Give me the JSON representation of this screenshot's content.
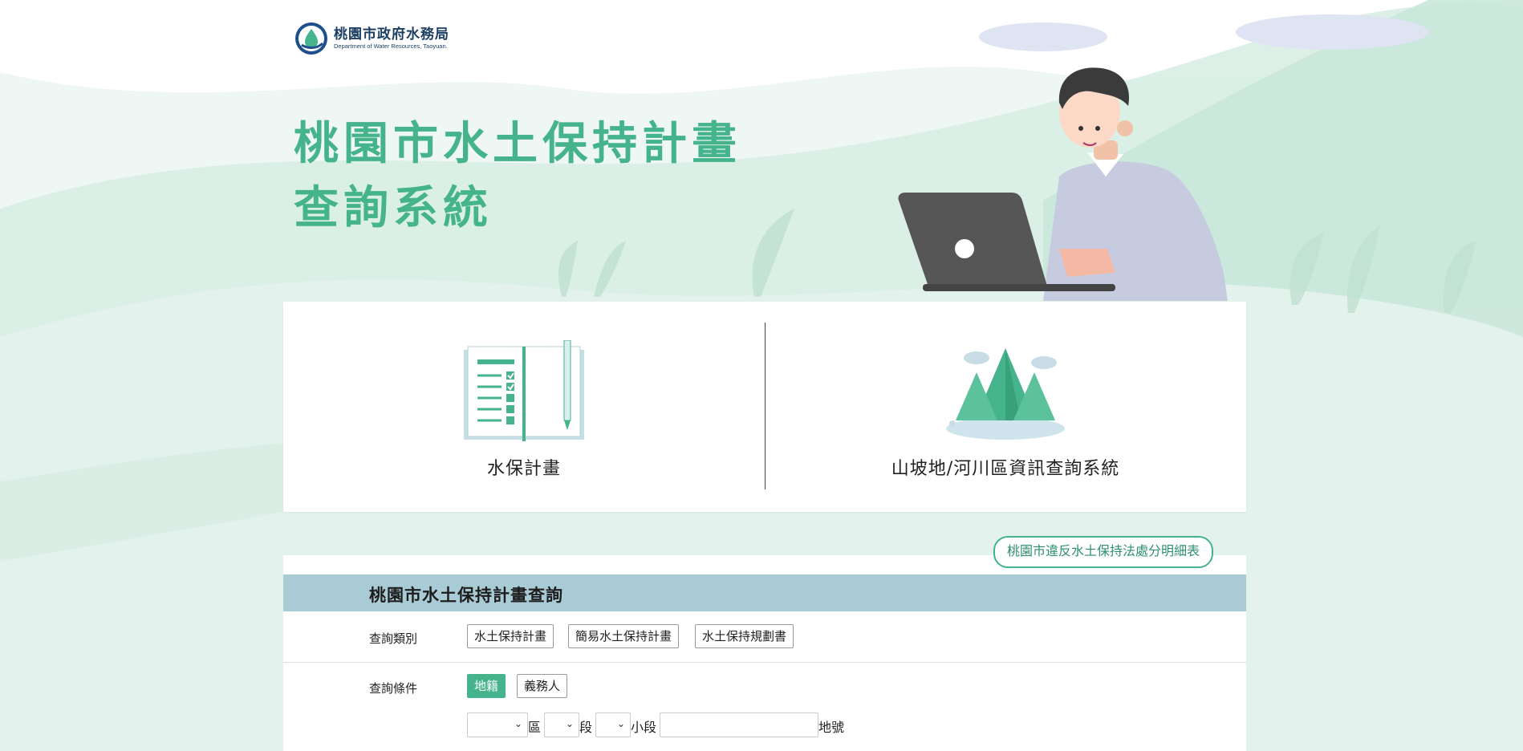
{
  "header": {
    "logo_zh": "桃園市政府水務局",
    "logo_en": "Department of Water Resources, Taoyuan.",
    "hero_title_line1": "桃園市水土保持計畫",
    "hero_title_line2": "查詢系統"
  },
  "nav_cards": [
    {
      "label": "水保計畫",
      "icon": "notebook-checklist-icon"
    },
    {
      "label": "山坡地/河川區資訊查詢系統",
      "icon": "mountain-icon"
    }
  ],
  "penalty_link": "桃園市違反水土保持法處分明細表",
  "search_panel": {
    "title": "桃園市水土保持計畫查詢",
    "category_label": "查詢類別",
    "category_options": [
      "水土保持計畫",
      "簡易水土保持計畫",
      "水土保持規劃書"
    ],
    "condition_label": "查詢條件",
    "condition_tabs": [
      {
        "label": "地籍",
        "active": true
      },
      {
        "label": "義務人",
        "active": false
      }
    ],
    "district_label": "區",
    "section_label": "段",
    "subsection_label": "小段",
    "lot_number_label": "地號",
    "district_value": "",
    "section_value": "",
    "subsection_value": "",
    "lot_number_value": ""
  },
  "colors": {
    "brand_green": "#45b38b",
    "panel_header": "#a9cbd6",
    "logo_navy": "#1d3f63",
    "background": "#eef7f3"
  }
}
